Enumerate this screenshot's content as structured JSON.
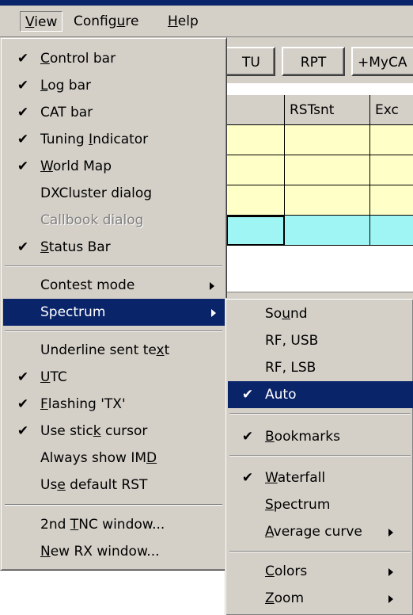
{
  "menubar": {
    "items": [
      {
        "pre": "",
        "key": "V",
        "post": "iew"
      },
      {
        "pre": "Config",
        "key": "u",
        "post": "re"
      },
      {
        "pre": "",
        "key": "H",
        "post": "elp"
      }
    ]
  },
  "toolbar": {
    "buttons": [
      "TU",
      "RPT",
      "+MyCA"
    ]
  },
  "grid": {
    "headers": [
      "",
      "RSTsnt",
      "Exc"
    ]
  },
  "view_menu": {
    "items": [
      {
        "check": "✔",
        "pre": "",
        "key": "C",
        "post": "ontrol bar"
      },
      {
        "check": "✔",
        "pre": "",
        "key": "L",
        "post": "og bar"
      },
      {
        "check": "✔",
        "pre": "CAT bar",
        "key": "",
        "post": ""
      },
      {
        "check": "✔",
        "pre": "Tuning ",
        "key": "I",
        "post": "ndicator"
      },
      {
        "check": "✔",
        "pre": "",
        "key": "W",
        "post": "orld Map"
      },
      {
        "check": "",
        "pre": "DXCluster dialog",
        "key": "",
        "post": ""
      },
      {
        "check": "",
        "pre": "Callbook dialog",
        "key": "",
        "post": "",
        "disabled": true
      },
      {
        "check": "✔",
        "pre": "",
        "key": "S",
        "post": "tatus Bar"
      },
      {
        "check": "",
        "pre": "Contest mode",
        "key": "",
        "post": "",
        "submenu": true
      },
      {
        "check": "",
        "pre": "Spectrum",
        "key": "",
        "post": "",
        "submenu": true,
        "highlighted": true
      },
      {
        "check": "",
        "pre": "Underline sent te",
        "key": "x",
        "post": "t"
      },
      {
        "check": "✔",
        "pre": "",
        "key": "U",
        "post": "TC"
      },
      {
        "check": "✔",
        "pre": "",
        "key": "F",
        "post": "lashing 'TX'"
      },
      {
        "check": "✔",
        "pre": "Use stic",
        "key": "k",
        "post": " cursor"
      },
      {
        "check": "",
        "pre": "Always show IM",
        "key": "D",
        "post": ""
      },
      {
        "check": "",
        "pre": "Us",
        "key": "e",
        "post": " default RST"
      },
      {
        "check": "",
        "pre": "2nd ",
        "key": "T",
        "post": "NC window..."
      },
      {
        "check": "",
        "pre": "",
        "key": "N",
        "post": "ew RX window..."
      }
    ]
  },
  "spectrum_menu": {
    "items": [
      {
        "check": "",
        "pre": "So",
        "key": "u",
        "post": "nd"
      },
      {
        "check": "",
        "pre": "RF, USB",
        "key": "",
        "post": ""
      },
      {
        "check": "",
        "pre": "RF, LSB",
        "key": "",
        "post": ""
      },
      {
        "check": "✔",
        "pre": "Auto",
        "key": "",
        "post": "",
        "highlighted": true
      },
      {
        "check": "✔",
        "pre": "",
        "key": "B",
        "post": "ookmarks"
      },
      {
        "check": "✔",
        "pre": "",
        "key": "W",
        "post": "aterfall"
      },
      {
        "check": "",
        "pre": "",
        "key": "S",
        "post": "pectrum"
      },
      {
        "check": "",
        "pre": "",
        "key": "A",
        "post": "verage curve",
        "submenu": true
      },
      {
        "check": "",
        "pre": "",
        "key": "C",
        "post": "olors",
        "submenu": true
      },
      {
        "check": "",
        "pre": "",
        "key": "Z",
        "post": "oom",
        "submenu": true
      }
    ]
  }
}
